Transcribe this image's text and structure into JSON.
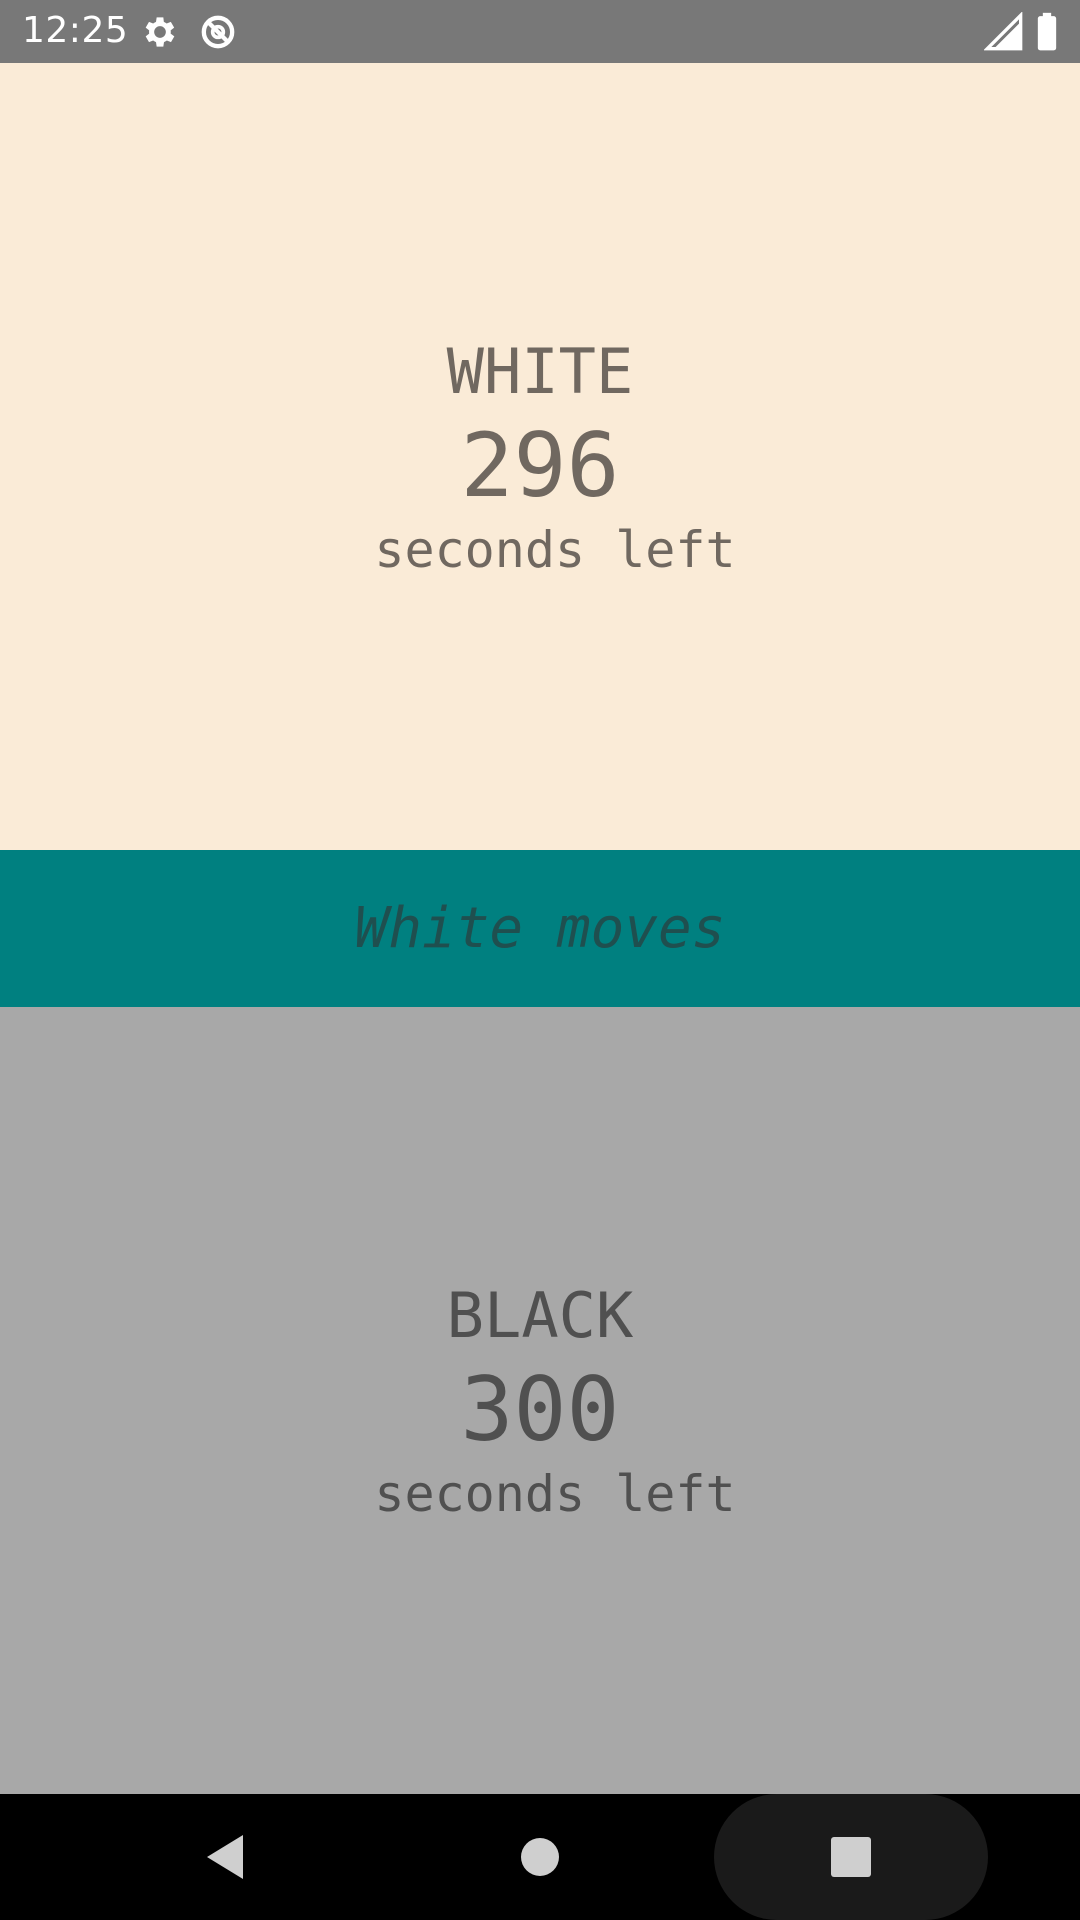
{
  "status_bar": {
    "time": "12:25",
    "icons": [
      "gear-icon",
      "sync-disabled-icon",
      "signal-icon",
      "battery-icon"
    ]
  },
  "white_player": {
    "name": "WHITE",
    "seconds": "296",
    "unit_label": "seconds left"
  },
  "turn": {
    "label": "White moves"
  },
  "black_player": {
    "name": "BLACK",
    "seconds": "300",
    "unit_label": "seconds left"
  },
  "nav_bar": {
    "buttons": [
      "back-icon",
      "home-icon",
      "recents-icon"
    ]
  },
  "colors": {
    "status_bar": "#787878",
    "white_panel": "#faebd7",
    "turn_bar": "#008080",
    "black_panel": "#a8a8a8",
    "nav_bar": "#000000"
  }
}
